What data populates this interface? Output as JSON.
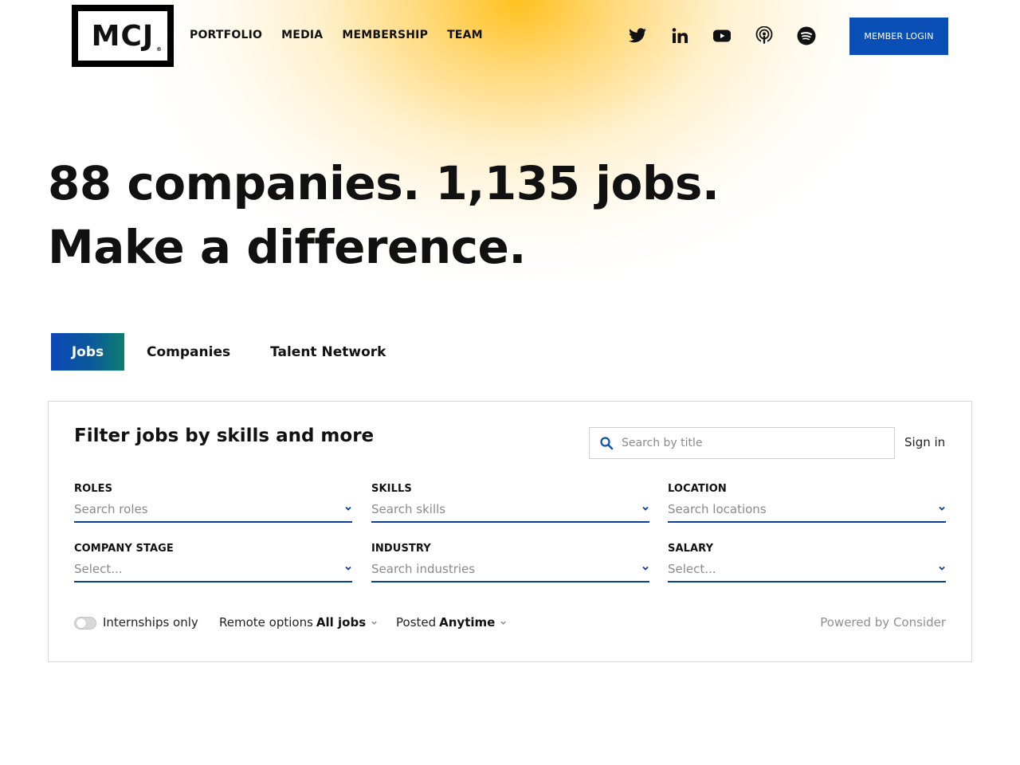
{
  "header": {
    "logo_text": "MCJ",
    "logo_mark": "®",
    "nav": [
      {
        "label": "PORTFOLIO"
      },
      {
        "label": "MEDIA"
      },
      {
        "label": "MEMBERSHIP"
      },
      {
        "label": "TEAM"
      }
    ],
    "social_icons": [
      "twitter-icon",
      "linkedin-icon",
      "youtube-icon",
      "podcast-icon",
      "spotify-icon"
    ],
    "member_login": "MEMBER LOGIN"
  },
  "hero": {
    "line1": "88 companies. 1,135 jobs.",
    "line2": "Make a difference."
  },
  "tabs": [
    {
      "label": "Jobs",
      "active": true
    },
    {
      "label": "Companies",
      "active": false
    },
    {
      "label": "Talent Network",
      "active": false
    }
  ],
  "filters": {
    "title": "Filter jobs by skills and more",
    "search_placeholder": "Search by title",
    "sign_in": "Sign in",
    "fields": [
      {
        "label": "ROLES",
        "placeholder": "Search roles"
      },
      {
        "label": "SKILLS",
        "placeholder": "Search skills"
      },
      {
        "label": "LOCATION",
        "placeholder": "Search locations"
      },
      {
        "label": "COMPANY STAGE",
        "placeholder": "Select..."
      },
      {
        "label": "INDUSTRY",
        "placeholder": "Search industries"
      },
      {
        "label": "SALARY",
        "placeholder": "Select..."
      }
    ],
    "internships_label": "Internships only",
    "remote_prefix": "Remote options",
    "remote_value": "All jobs",
    "posted_prefix": "Posted",
    "posted_value": "Anytime",
    "powered_by": "Powered by Consider"
  },
  "colors": {
    "accent_blue": "#0a4fb5",
    "field_underline": "#0a3f8f",
    "glow_yellow": "#ffbe14"
  }
}
